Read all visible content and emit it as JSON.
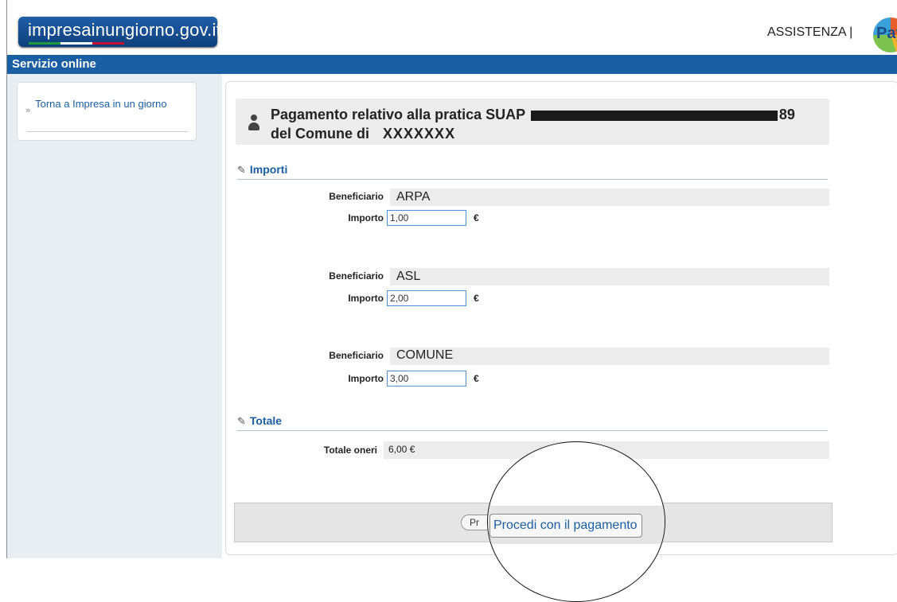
{
  "header": {
    "logo_text": "impresainungiorno.gov.it",
    "assistenza": "ASSISTENZA |",
    "pay_logo": "Pay",
    "flag_colors": [
      "#1e9a3c",
      "#ffffff",
      "#c8102e"
    ]
  },
  "service_bar": {
    "title": "Servizio online"
  },
  "sidebar": {
    "link_label": "Torna a Impresa in un giorno",
    "bullet": "»"
  },
  "title": {
    "line1_prefix": "Pagamento relativo alla pratica SUAP",
    "line1_suffix": "89",
    "line2_prefix": "del Comune di",
    "comune": "XXXXXXX"
  },
  "importi": {
    "heading": "Importi",
    "beneficiario_label": "Beneficiario",
    "importo_label": "Importo",
    "currency": "€",
    "rows": [
      {
        "beneficiario": "ARPA",
        "importo": "1,00"
      },
      {
        "beneficiario": "ASL",
        "importo": "2,00"
      },
      {
        "beneficiario": "COMUNE",
        "importo": "3,00"
      }
    ]
  },
  "totale": {
    "heading": "Totale",
    "label": "Totale oneri",
    "value": "6,00 €"
  },
  "actions": {
    "proceed_partial": "Pr",
    "proceed_label": "Procedi con il pagamento"
  },
  "colors": {
    "brand_blue": "#1a5fa3",
    "logo_blue": "#1f5fa6",
    "panel_grey": "#ececec",
    "input_border": "#4a90d9"
  }
}
